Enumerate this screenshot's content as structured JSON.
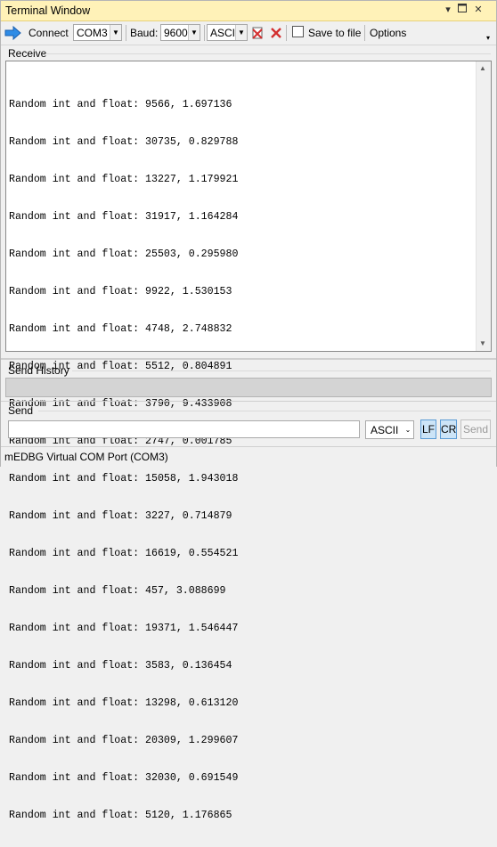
{
  "window": {
    "title": "Terminal Window"
  },
  "toolbar": {
    "connect_label": "Connect",
    "port_value": "COM3",
    "baud_label": "Baud:",
    "baud_value": "9600",
    "format_value": "ASCII",
    "save_to_file_label": "Save to file",
    "options_label": "Options",
    "icons": [
      "connect-arrow-icon",
      "clear-red-icon",
      "clear-all-red-icon"
    ]
  },
  "receive": {
    "label": "Receive",
    "lines": [
      "Random int and float: 9566, 1.697136",
      "Random int and float: 30735, 0.829788",
      "Random int and float: 13227, 1.179921",
      "Random int and float: 31917, 1.164284",
      "Random int and float: 25503, 0.295980",
      "Random int and float: 9922, 1.530153",
      "Random int and float: 4748, 2.748832",
      "Random int and float: 5512, 0.804891",
      "Random int and float: 3790, 9.433908",
      "Random int and float: 2747, 0.001785",
      "Random int and float: 15058, 1.943018",
      "Random int and float: 3227, 0.714879",
      "Random int and float: 16619, 0.554521",
      "Random int and float: 457, 3.088699",
      "Random int and float: 19371, 1.546447",
      "Random int and float: 3583, 0.136454",
      "Random int and float: 13298, 0.613120",
      "Random int and float: 20309, 1.299607",
      "Random int and float: 32030, 0.691549",
      "Random int and float: 5120, 1.176865"
    ]
  },
  "history": {
    "label": "Send History"
  },
  "send": {
    "label": "Send",
    "input_value": "",
    "format_value": "ASCII",
    "lf_label": "LF",
    "cr_label": "CR",
    "send_label": "Send"
  },
  "status": {
    "text": "mEDBG Virtual COM Port (COM3)"
  },
  "colors": {
    "titlebar": "#fff2b8",
    "accent": "#1e73d8",
    "clear_icon": "#d32f2f"
  }
}
